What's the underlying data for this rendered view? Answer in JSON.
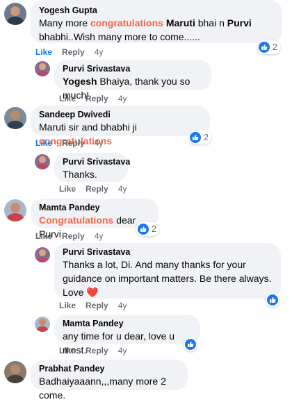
{
  "comments": [
    {
      "name": "Yogesh Gupta",
      "text1_a": "Many more ",
      "text1_b": "congratulations",
      "text1_c": " ",
      "text1_d": "Maruti",
      "text1_e": " bhai n ",
      "text1_f": "Purvi",
      "text2": "bhabhi..Wish many more to come......",
      "like": "Like",
      "reply": "Reply",
      "time": "4y",
      "reactions": "2"
    },
    {
      "name": "Purvi Srivastava",
      "text_a": "Yogesh",
      "text_b": " Bhaiya, thank you so much!",
      "like": "Like",
      "reply": "Reply",
      "time": "4y"
    },
    {
      "name": "Sandeep Dwivedi",
      "text_a": "Maruti sir and bhabhi ji ",
      "text_b": "congratulations",
      "like": "Like",
      "reply": "Reply",
      "time": "4y",
      "reactions": "2"
    },
    {
      "name": "Purvi Srivastava",
      "text": "Thanks.",
      "like": "Like",
      "reply": "Reply",
      "time": "4y"
    },
    {
      "name": "Mamta Pandey",
      "text_a": "Congratulations",
      "text_b": " dear Purvi",
      "like": "Like",
      "reply": "Reply",
      "time": "4y",
      "reactions": "2"
    },
    {
      "name": "Purvi Srivastava",
      "line1": "Thanks a lot, Di. And many thanks for your",
      "line2": "guidance on important matters. Be there always.",
      "line3": "Love",
      "heart": "❤️",
      "like": "Like",
      "reply": "Reply",
      "time": "4y"
    },
    {
      "name": "Mamta Pandey",
      "text": "any time for u dear, love u most.",
      "like": "Like",
      "reply": "Reply",
      "time": "4y"
    },
    {
      "name": "Prabhat Pandey",
      "text": "Badhaiyaaann,,,many more 2 come."
    }
  ],
  "colors": {
    "highlight": "#f0674a",
    "like_blue": "#1877f2",
    "bubble": "#f0f2f5"
  }
}
